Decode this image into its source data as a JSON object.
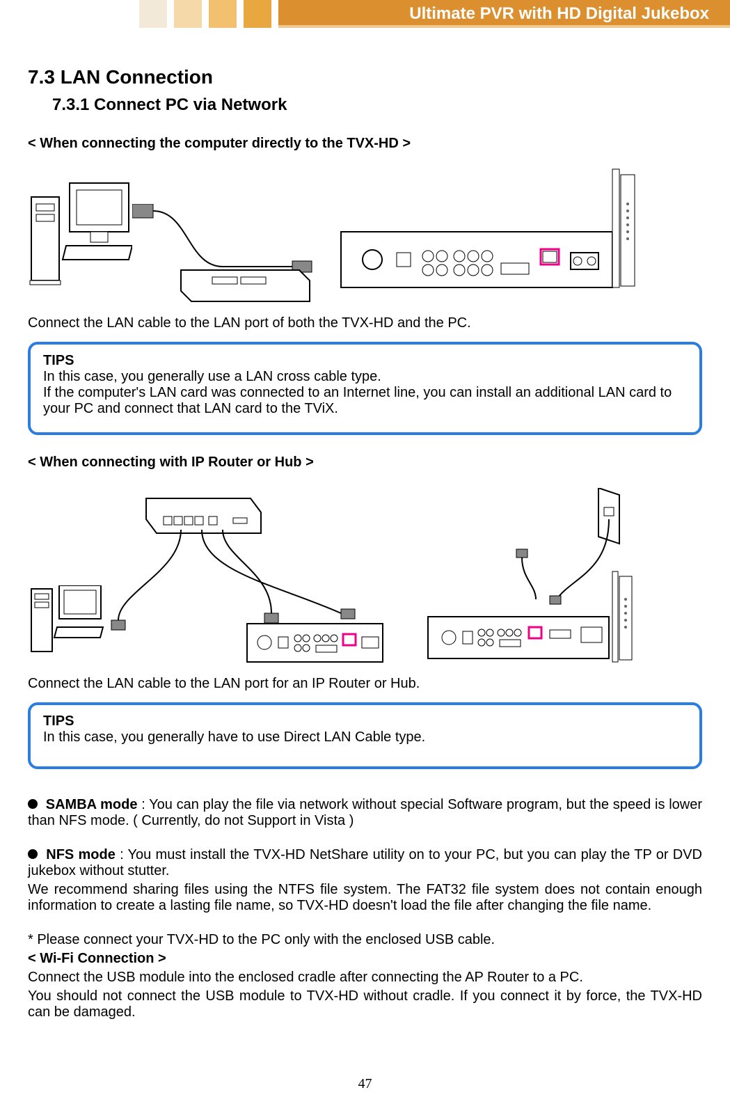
{
  "header": {
    "title": "Ultimate PVR with HD Digital Jukebox"
  },
  "section": {
    "number_title": "7.3    LAN Connection"
  },
  "subsection": {
    "number_title": "7.3.1 Connect    PC via Network"
  },
  "scenario1": {
    "heading": "< When connecting the computer directly to the TVX-HD >",
    "caption": "Connect the LAN cable to the LAN port of both the TVX-HD and the PC."
  },
  "tips1": {
    "title": "TIPS",
    "line1": "In this case, you generally use a LAN cross cable type.",
    "line2": "If the computer's LAN card was connected to an Internet line, you can install an additional LAN card to your PC and connect that LAN card to the TViX."
  },
  "scenario2": {
    "heading": "< When connecting with IP Router or Hub >",
    "caption": "Connect the LAN cable to the LAN port for an IP Router or Hub."
  },
  "tips2": {
    "title": "TIPS",
    "line1": "In this case, you generally have to use Direct LAN Cable type."
  },
  "modes": {
    "samba_label": "SAMBA mode",
    "samba_text": " : You can play the file via network without special Software program, but the speed is lower than NFS mode. ( Currently, do not Support in Vista )",
    "nfs_label": "NFS mode",
    "nfs_text": " : You must install the TVX-HD NetShare utility on to your PC, but you can play the TP or DVD jukebox without stutter.",
    "rec_text": "We recommend sharing files using the NTFS file system. The FAT32 file system does not contain enough information to create a lasting file name, so TVX-HD doesn't load the file after changing the file name.",
    "usb_note": "* Please connect your TVX-HD to the PC only with the enclosed USB cable.",
    "wifi_heading": "< Wi-Fi Connection >",
    "wifi_line1": "Connect the USB module into the enclosed cradle after connecting the AP Router to a PC.",
    "wifi_line2": "You should not connect the USB module to TVX-HD without cradle. If you connect it by force, the TVX-HD can be damaged."
  },
  "page_number": "47"
}
